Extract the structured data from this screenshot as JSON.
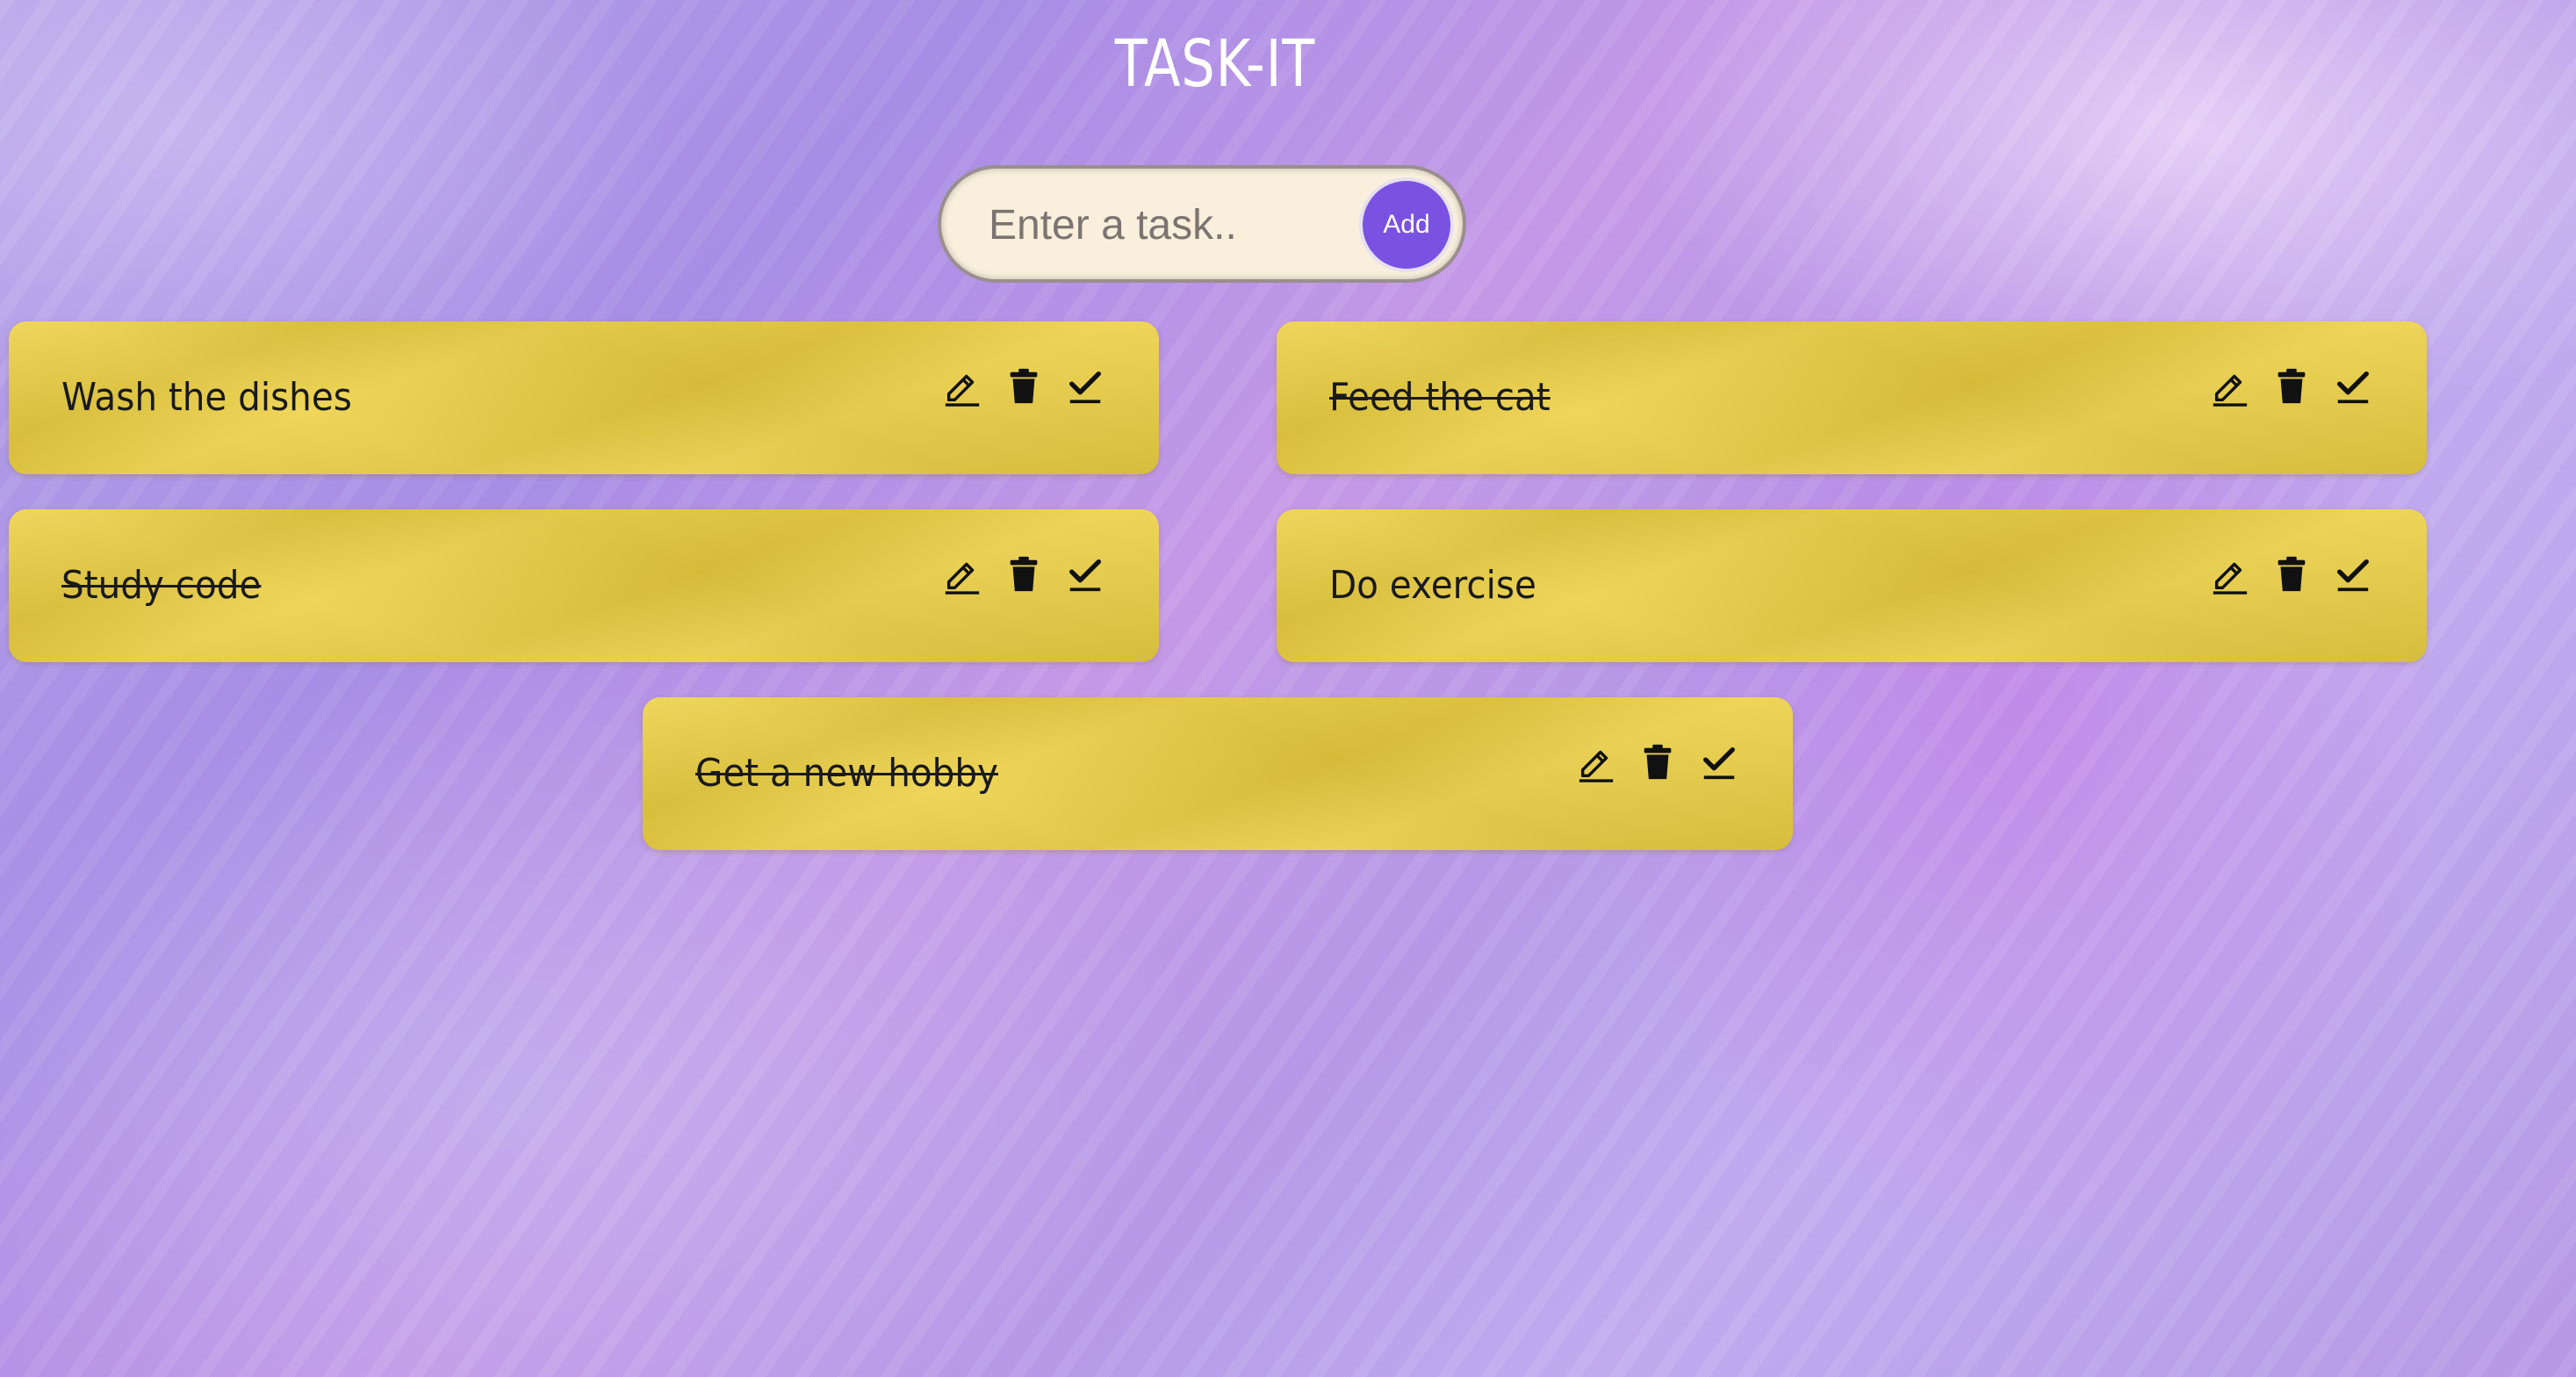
{
  "app": {
    "title": "TASK-IT"
  },
  "add_task": {
    "placeholder": "Enter a task..",
    "value": "",
    "button_label": "Add",
    "button_color": "#7a52e2"
  },
  "colors": {
    "note": "#eccf3e",
    "input_background": "#f9efdc"
  },
  "tasks": [
    {
      "label": "Wash the dishes",
      "completed": false,
      "icons": [
        "edit-icon",
        "trash-icon",
        "check-icon"
      ]
    },
    {
      "label": "Feed the cat",
      "completed": true,
      "icons": [
        "edit-icon",
        "trash-icon",
        "check-icon"
      ]
    },
    {
      "label": "Study code",
      "completed": true,
      "icons": [
        "edit-icon",
        "trash-icon",
        "check-icon"
      ]
    },
    {
      "label": "Do exercise",
      "completed": false,
      "icons": [
        "edit-icon",
        "trash-icon",
        "check-icon"
      ]
    },
    {
      "label": "Get a new hobby",
      "completed": true,
      "icons": [
        "edit-icon",
        "trash-icon",
        "check-icon"
      ]
    }
  ]
}
